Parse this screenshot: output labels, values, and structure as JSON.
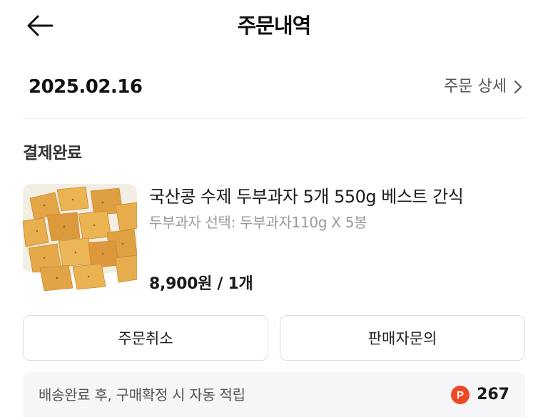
{
  "header": {
    "title": "주문내역",
    "back_icon": "arrow-left-icon"
  },
  "order": {
    "date": "2025.02.16",
    "detail_link_label": "주문 상세",
    "detail_icon": "chevron-right-icon",
    "status": "결제완료"
  },
  "product": {
    "name": "국산콩 수제 두부과자 5개 550g 베스트 간식",
    "option": "두부과자 선택: 두부과자110g X 5봉",
    "price": "8,900원 / 1개",
    "image_icon": "tofu-snack-photo"
  },
  "actions": {
    "cancel_label": "주문취소",
    "inquiry_label": "판매자문의"
  },
  "points": {
    "text": "배송완료 후, 구매확정 시 자동 적립",
    "badge": "P",
    "value": "267",
    "badge_color": "#ec4a26"
  }
}
